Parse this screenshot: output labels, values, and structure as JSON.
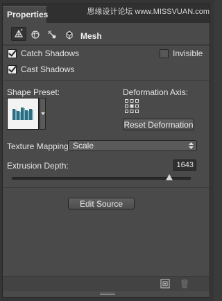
{
  "panel": {
    "tab_label": "Properties",
    "watermark": "思缘设计论坛 www.MISSVUAN.com"
  },
  "mode_bar": {
    "buttons": [
      {
        "name": "scene-icon"
      },
      {
        "name": "mesh-icon",
        "selected": true
      },
      {
        "name": "light-icon"
      },
      {
        "name": "coordinates-icon"
      }
    ],
    "label": "Mesh"
  },
  "options": {
    "catch_shadows": {
      "label": "Catch Shadows",
      "checked": true
    },
    "invisible": {
      "label": "Invisible",
      "checked": false
    },
    "cast_shadows": {
      "label": "Cast Shadows",
      "checked": true
    }
  },
  "shape_preset": {
    "label": "Shape Preset:"
  },
  "deformation": {
    "axis_label": "Deformation Axis:",
    "reset_button": "Reset Deformation"
  },
  "texture_mapping": {
    "label": "Texture Mapping:",
    "value": "Scale"
  },
  "extrusion": {
    "label": "Extrusion Depth:",
    "value": "1643",
    "slider_fraction": 0.88
  },
  "edit_source_button": "Edit Source",
  "colors": {
    "panel_bg": "#4a4a4a",
    "tabbar_bg": "#303030",
    "text": "#e6e6e6"
  }
}
